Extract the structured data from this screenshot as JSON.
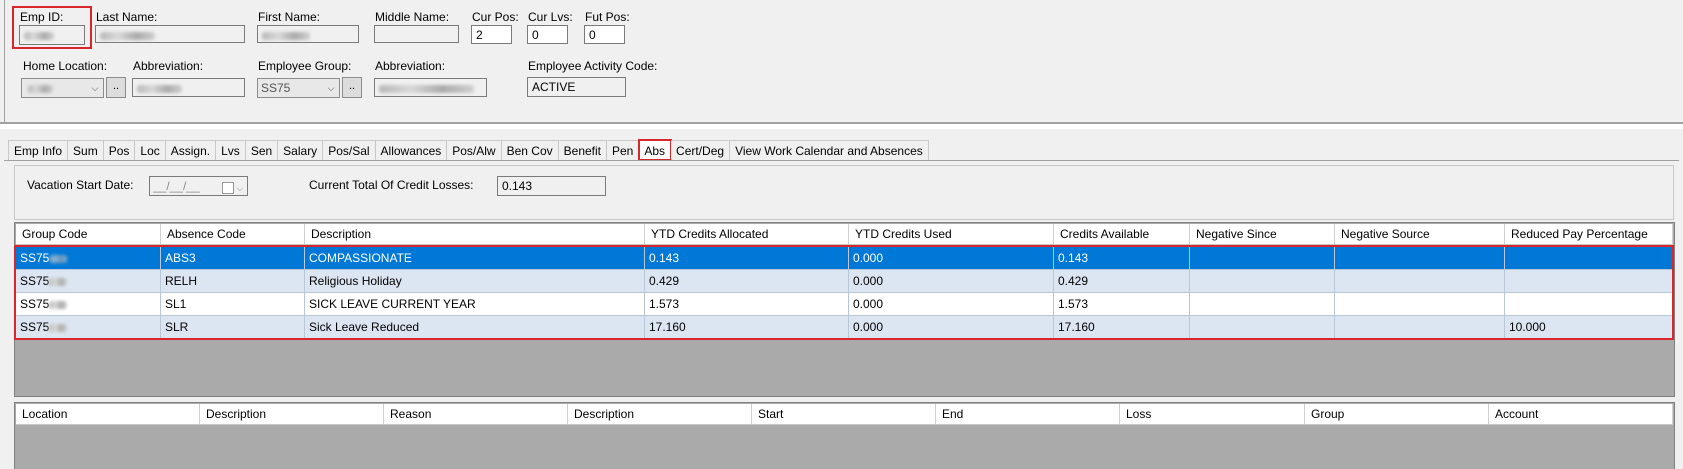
{
  "header": {
    "emp_id_label": "Emp ID:",
    "last_name_label": "Last Name:",
    "first_name_label": "First Name:",
    "middle_name_label": "Middle Name:",
    "cur_pos_label": "Cur Pos:",
    "cur_pos_value": "2",
    "cur_lvs_label": "Cur Lvs:",
    "cur_lvs_value": "0",
    "fut_pos_label": "Fut Pos:",
    "fut_pos_value": "0",
    "home_location_label": "Home Location:",
    "abbreviation_label": "Abbreviation:",
    "employee_group_label": "Employee Group:",
    "employee_group_value": "SS75",
    "abbreviation2_label": "Abbreviation:",
    "activity_code_label": "Employee Activity Code:",
    "activity_code_value": "ACTIVE",
    "dots_label": ".."
  },
  "tabs": [
    {
      "label": "Emp Info"
    },
    {
      "label": "Sum"
    },
    {
      "label": "Pos"
    },
    {
      "label": "Loc"
    },
    {
      "label": "Assign."
    },
    {
      "label": "Lvs"
    },
    {
      "label": "Sen"
    },
    {
      "label": "Salary"
    },
    {
      "label": "Pos/Sal"
    },
    {
      "label": "Allowances"
    },
    {
      "label": "Pos/Alw"
    },
    {
      "label": "Ben Cov"
    },
    {
      "label": "Benefit"
    },
    {
      "label": "Pen"
    },
    {
      "label": "Abs"
    },
    {
      "label": "Cert/Deg"
    },
    {
      "label": "View Work Calendar and Absences"
    }
  ],
  "abs_panel": {
    "vacation_start_label": "Vacation Start Date:",
    "vacation_start_value": "__/__/__",
    "credit_losses_label": "Current Total Of Credit Losses:",
    "credit_losses_value": "0.143"
  },
  "abs_grid": {
    "columns": [
      "Group Code",
      "Absence Code",
      "Description",
      "YTD Credits Allocated",
      "YTD Credits Used",
      "Credits Available",
      "Negative Since",
      "Negative Source",
      "Reduced Pay Percentage"
    ],
    "rows": [
      [
        "SS75",
        "ABS3",
        "COMPASSIONATE",
        "0.143",
        "0.000",
        "0.143",
        "",
        "",
        ""
      ],
      [
        "SS75",
        "RELH",
        "Religious Holiday",
        "0.429",
        "0.000",
        "0.429",
        "",
        "",
        ""
      ],
      [
        "SS75",
        "SL1",
        "SICK LEAVE CURRENT YEAR",
        "1.573",
        "0.000",
        "1.573",
        "",
        "",
        ""
      ],
      [
        "SS75",
        "SLR",
        "Sick Leave Reduced",
        "17.160",
        "0.000",
        "17.160",
        "",
        "",
        "10.000"
      ]
    ]
  },
  "loss_grid": {
    "columns": [
      "Location",
      "Description",
      "Reason",
      "Description",
      "Start",
      "End",
      "Loss",
      "Group",
      "Account"
    ]
  }
}
